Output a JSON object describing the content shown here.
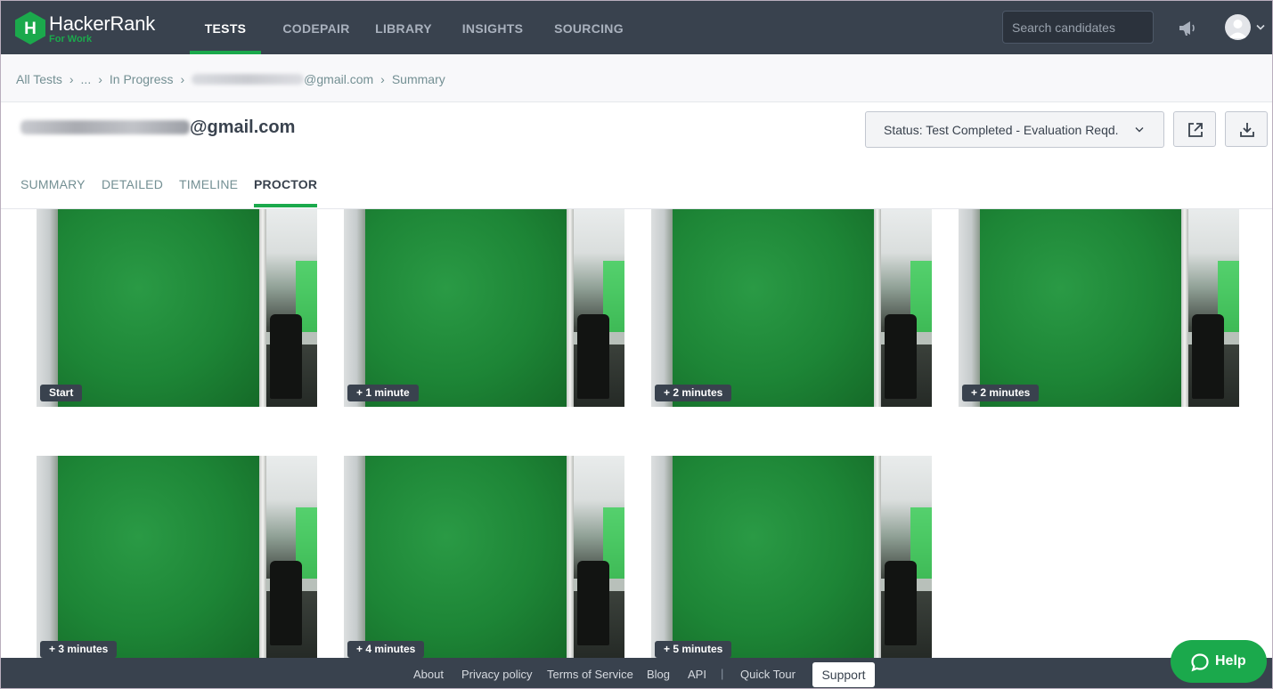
{
  "app": {
    "brand": "HackerRank",
    "brand_sub": "For Work",
    "brand_color": "#1ba94c"
  },
  "nav": {
    "tabs": [
      {
        "label": "TESTS",
        "active": true
      },
      {
        "label": "CODEPAIR",
        "active": false
      },
      {
        "label": "LIBRARY",
        "active": false
      },
      {
        "label": "INSIGHTS",
        "active": false
      },
      {
        "label": "SOURCING",
        "active": false
      }
    ],
    "search_placeholder": "Search candidates"
  },
  "breadcrumb": {
    "items": [
      "All Tests",
      "...",
      "In Progress",
      "@gmail.com",
      "Summary"
    ]
  },
  "candidate": {
    "email_visible": "@gmail.com"
  },
  "header": {
    "status_label": "Status: Test Completed - Evaluation Reqd."
  },
  "tabs": [
    {
      "label": "SUMMARY",
      "active": false
    },
    {
      "label": "DETAILED",
      "active": false
    },
    {
      "label": "TIMELINE",
      "active": false
    },
    {
      "label": "PROCTOR",
      "active": true
    }
  ],
  "snapshots": [
    {
      "label": "Start"
    },
    {
      "label": "+ 1 minute"
    },
    {
      "label": "+ 2 minutes"
    },
    {
      "label": "+ 2 minutes"
    },
    {
      "label": "+ 3 minutes"
    },
    {
      "label": "+ 4 minutes"
    },
    {
      "label": "+ 5 minutes"
    }
  ],
  "footer": {
    "links": [
      "About",
      "Privacy policy",
      "Terms of Service",
      "Blog",
      "API",
      "Quick Tour"
    ],
    "separator": "|",
    "support": "Support"
  },
  "help": {
    "label": "Help"
  }
}
